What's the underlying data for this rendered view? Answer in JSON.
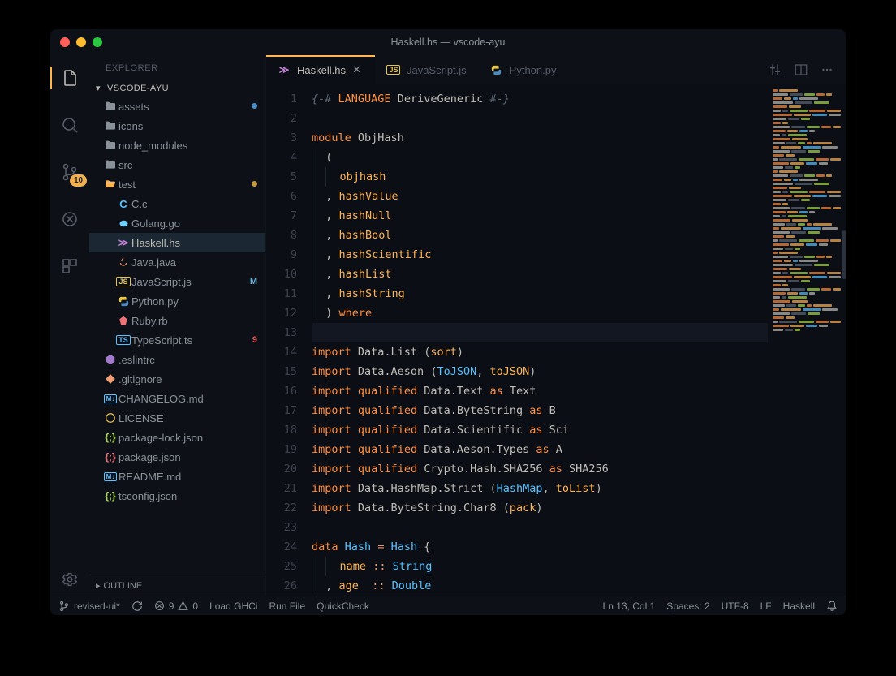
{
  "titlebar": {
    "title": "Haskell.hs — vscode-ayu"
  },
  "activitybar": {
    "badge_scm": "10"
  },
  "sidebar": {
    "title": "EXPLORER",
    "workspace": "VSCODE-AYU",
    "outline": "OUTLINE",
    "tree": [
      {
        "icon": "folder",
        "label": "assets",
        "depth": 0,
        "decor_dot": "blue"
      },
      {
        "icon": "folder",
        "label": "icons",
        "depth": 0
      },
      {
        "icon": "folder",
        "label": "node_modules",
        "depth": 0
      },
      {
        "icon": "folder",
        "label": "src",
        "depth": 0
      },
      {
        "icon": "folder-open",
        "label": "test",
        "depth": 0,
        "open": true,
        "decor_dot": "yel"
      },
      {
        "icon": "c",
        "label": "C.c",
        "depth": 1
      },
      {
        "icon": "go",
        "label": "Golang.go",
        "depth": 1
      },
      {
        "icon": "haskell",
        "label": "Haskell.hs",
        "depth": 1,
        "selected": true
      },
      {
        "icon": "java",
        "label": "Java.java",
        "depth": 1
      },
      {
        "icon": "js",
        "label": "JavaScript.js",
        "depth": 1,
        "git": "M"
      },
      {
        "icon": "python",
        "label": "Python.py",
        "depth": 1
      },
      {
        "icon": "ruby",
        "label": "Ruby.rb",
        "depth": 1
      },
      {
        "icon": "ts",
        "label": "TypeScript.ts",
        "depth": 1,
        "git": "9",
        "err": true
      },
      {
        "icon": "eslint",
        "label": ".eslintrc",
        "depth": 0
      },
      {
        "icon": "git",
        "label": ".gitignore",
        "depth": 0
      },
      {
        "icon": "md",
        "label": "CHANGELOG.md",
        "depth": 0
      },
      {
        "icon": "license",
        "label": "LICENSE",
        "depth": 0
      },
      {
        "icon": "json",
        "label": "package-lock.json",
        "depth": 0
      },
      {
        "icon": "json2",
        "label": "package.json",
        "depth": 0
      },
      {
        "icon": "md",
        "label": "README.md",
        "depth": 0
      },
      {
        "icon": "json",
        "label": "tsconfig.json",
        "depth": 0
      }
    ]
  },
  "tabs": [
    {
      "icon": "haskell",
      "label": "Haskell.hs",
      "active": true,
      "close": true
    },
    {
      "icon": "js",
      "label": "JavaScript.js"
    },
    {
      "icon": "python",
      "label": "Python.py"
    }
  ],
  "statusbar": {
    "branch": "revised-ui*",
    "errors": "9",
    "warnings": "0",
    "task1": "Load GHCi",
    "task2": "Run File",
    "task3": "QuickCheck",
    "pos": "Ln 13, Col 1",
    "spaces": "Spaces: 2",
    "encoding": "UTF-8",
    "eol": "LF",
    "lang": "Haskell"
  },
  "editor": {
    "cursor_line": 13,
    "lines": [
      [
        {
          "c": "comment",
          "t": "{-#"
        },
        {
          "c": "plain",
          "t": " "
        },
        {
          "c": "pragma",
          "t": "LANGUAGE"
        },
        {
          "c": "plain",
          "t": " DeriveGeneric "
        },
        {
          "c": "comment",
          "t": "#-}"
        }
      ],
      [],
      [
        {
          "c": "keyword",
          "t": "module"
        },
        {
          "c": "plain",
          "t": " "
        },
        {
          "c": "module",
          "t": "ObjHash"
        }
      ],
      [
        {
          "i": 1
        },
        {
          "c": "paren",
          "t": "("
        }
      ],
      [
        {
          "i": 2
        },
        {
          "c": "ident",
          "t": "objhash"
        }
      ],
      [
        {
          "i": 1
        },
        {
          "c": "paren",
          "t": ", "
        },
        {
          "c": "ident",
          "t": "hashValue"
        }
      ],
      [
        {
          "i": 1
        },
        {
          "c": "paren",
          "t": ", "
        },
        {
          "c": "ident",
          "t": "hashNull"
        }
      ],
      [
        {
          "i": 1
        },
        {
          "c": "paren",
          "t": ", "
        },
        {
          "c": "ident",
          "t": "hashBool"
        }
      ],
      [
        {
          "i": 1
        },
        {
          "c": "paren",
          "t": ", "
        },
        {
          "c": "ident",
          "t": "hashScientific"
        }
      ],
      [
        {
          "i": 1
        },
        {
          "c": "paren",
          "t": ", "
        },
        {
          "c": "ident",
          "t": "hashList"
        }
      ],
      [
        {
          "i": 1
        },
        {
          "c": "paren",
          "t": ", "
        },
        {
          "c": "ident",
          "t": "hashString"
        }
      ],
      [
        {
          "i": 1
        },
        {
          "c": "paren",
          "t": ") "
        },
        {
          "c": "keyword",
          "t": "where"
        }
      ],
      [],
      [
        {
          "c": "keyword",
          "t": "import"
        },
        {
          "c": "plain",
          "t": " Data.List "
        },
        {
          "c": "paren",
          "t": "("
        },
        {
          "c": "ident",
          "t": "sort"
        },
        {
          "c": "paren",
          "t": ")"
        }
      ],
      [
        {
          "c": "keyword",
          "t": "import"
        },
        {
          "c": "plain",
          "t": " Data.Aeson "
        },
        {
          "c": "paren",
          "t": "("
        },
        {
          "c": "type",
          "t": "ToJSON"
        },
        {
          "c": "paren",
          "t": ", "
        },
        {
          "c": "ident",
          "t": "toJSON"
        },
        {
          "c": "paren",
          "t": ")"
        }
      ],
      [
        {
          "c": "keyword",
          "t": "import"
        },
        {
          "c": "plain",
          "t": " "
        },
        {
          "c": "keyword",
          "t": "qualified"
        },
        {
          "c": "plain",
          "t": " Data.Text "
        },
        {
          "c": "as",
          "t": "as"
        },
        {
          "c": "plain",
          "t": " Text"
        }
      ],
      [
        {
          "c": "keyword",
          "t": "import"
        },
        {
          "c": "plain",
          "t": " "
        },
        {
          "c": "keyword",
          "t": "qualified"
        },
        {
          "c": "plain",
          "t": " Data.ByteString "
        },
        {
          "c": "as",
          "t": "as"
        },
        {
          "c": "plain",
          "t": " B"
        }
      ],
      [
        {
          "c": "keyword",
          "t": "import"
        },
        {
          "c": "plain",
          "t": " "
        },
        {
          "c": "keyword",
          "t": "qualified"
        },
        {
          "c": "plain",
          "t": " Data.Scientific "
        },
        {
          "c": "as",
          "t": "as"
        },
        {
          "c": "plain",
          "t": " Sci"
        }
      ],
      [
        {
          "c": "keyword",
          "t": "import"
        },
        {
          "c": "plain",
          "t": " "
        },
        {
          "c": "keyword",
          "t": "qualified"
        },
        {
          "c": "plain",
          "t": " Data.Aeson.Types "
        },
        {
          "c": "as",
          "t": "as"
        },
        {
          "c": "plain",
          "t": " A"
        }
      ],
      [
        {
          "c": "keyword",
          "t": "import"
        },
        {
          "c": "plain",
          "t": " "
        },
        {
          "c": "keyword",
          "t": "qualified"
        },
        {
          "c": "plain",
          "t": " Crypto.Hash.SHA256 "
        },
        {
          "c": "as",
          "t": "as"
        },
        {
          "c": "plain",
          "t": " SHA256"
        }
      ],
      [
        {
          "c": "keyword",
          "t": "import"
        },
        {
          "c": "plain",
          "t": " Data.HashMap.Strict "
        },
        {
          "c": "paren",
          "t": "("
        },
        {
          "c": "type",
          "t": "HashMap"
        },
        {
          "c": "paren",
          "t": ", "
        },
        {
          "c": "ident",
          "t": "toList"
        },
        {
          "c": "paren",
          "t": ")"
        }
      ],
      [
        {
          "c": "keyword",
          "t": "import"
        },
        {
          "c": "plain",
          "t": " Data.ByteString.Char8 "
        },
        {
          "c": "paren",
          "t": "("
        },
        {
          "c": "ident",
          "t": "pack"
        },
        {
          "c": "paren",
          "t": ")"
        }
      ],
      [],
      [
        {
          "c": "keyword",
          "t": "data"
        },
        {
          "c": "plain",
          "t": " "
        },
        {
          "c": "type",
          "t": "Hash"
        },
        {
          "c": "plain",
          "t": " "
        },
        {
          "c": "op",
          "t": "="
        },
        {
          "c": "plain",
          "t": " "
        },
        {
          "c": "type",
          "t": "Hash"
        },
        {
          "c": "plain",
          "t": " "
        },
        {
          "c": "paren",
          "t": "{"
        }
      ],
      [
        {
          "i": 2
        },
        {
          "c": "ident",
          "t": "name"
        },
        {
          "c": "plain",
          "t": " "
        },
        {
          "c": "op",
          "t": "::"
        },
        {
          "c": "plain",
          "t": " "
        },
        {
          "c": "type",
          "t": "String"
        }
      ],
      [
        {
          "i": 1
        },
        {
          "c": "paren",
          "t": ", "
        },
        {
          "c": "ident",
          "t": "age "
        },
        {
          "c": "plain",
          "t": " "
        },
        {
          "c": "op",
          "t": "::"
        },
        {
          "c": "plain",
          "t": " "
        },
        {
          "c": "type",
          "t": "Double"
        }
      ]
    ]
  },
  "icons": {
    "folder": "#8a9199",
    "haskell": "#c27fd6",
    "js": "#e7c547",
    "python": "#e7c547",
    "c": "#59c2ff",
    "go": "#59c2ff",
    "java": "#f07178",
    "ruby": "#f07178",
    "ts": "#59c2ff",
    "md": "#59c2ff",
    "json": "#aad94c",
    "json2": "#f07178"
  }
}
